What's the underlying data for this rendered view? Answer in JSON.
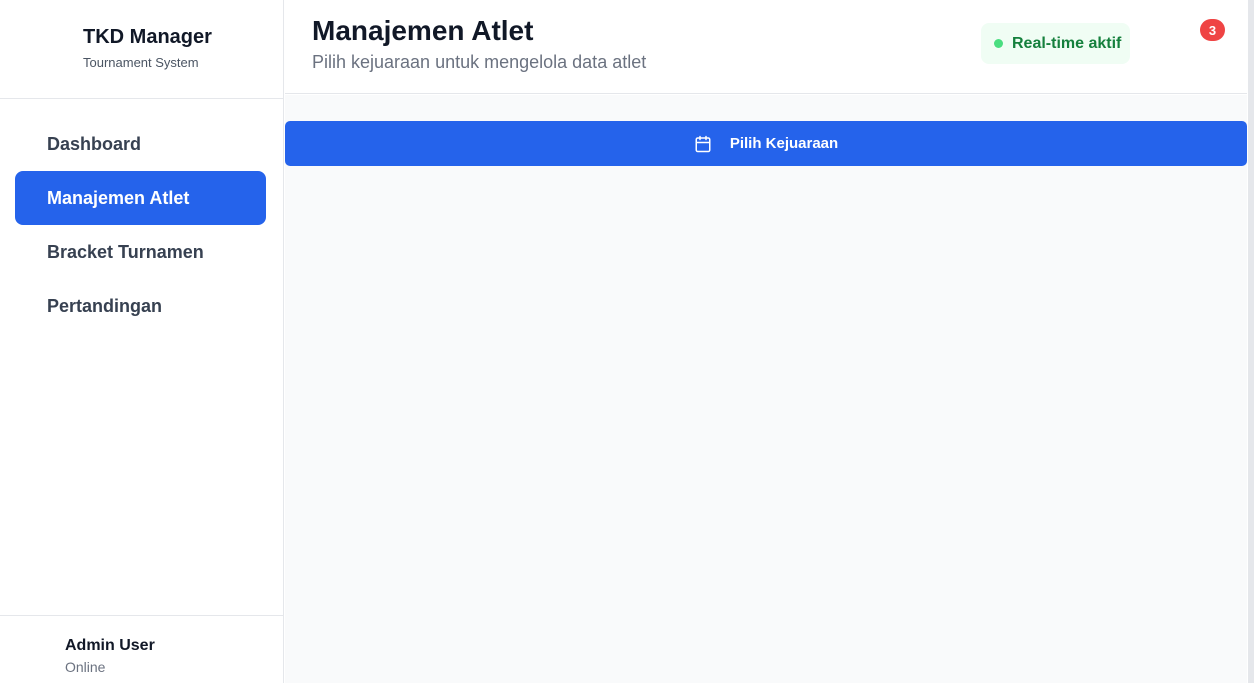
{
  "brand": {
    "title": "TKD Manager",
    "subtitle": "Tournament System"
  },
  "nav": {
    "items": [
      {
        "label": "Dashboard",
        "active": false
      },
      {
        "label": "Manajemen Atlet",
        "active": true
      },
      {
        "label": "Bracket Turnamen",
        "active": false
      },
      {
        "label": "Pertandingan",
        "active": false
      }
    ]
  },
  "user": {
    "name": "Admin User",
    "status": "Online"
  },
  "header": {
    "title": "Manajemen Atlet",
    "subtitle": "Pilih kejuaraan untuk mengelola data atlet",
    "realtime_label": "Real-time aktif",
    "notification_count": "3"
  },
  "main": {
    "select_button_label": "Pilih Kejuaraan",
    "select_button_icon": "calendar-icon"
  },
  "colors": {
    "accent": "#2563eb",
    "realtime_green": "#15803d",
    "badge_red": "#ef4444"
  }
}
